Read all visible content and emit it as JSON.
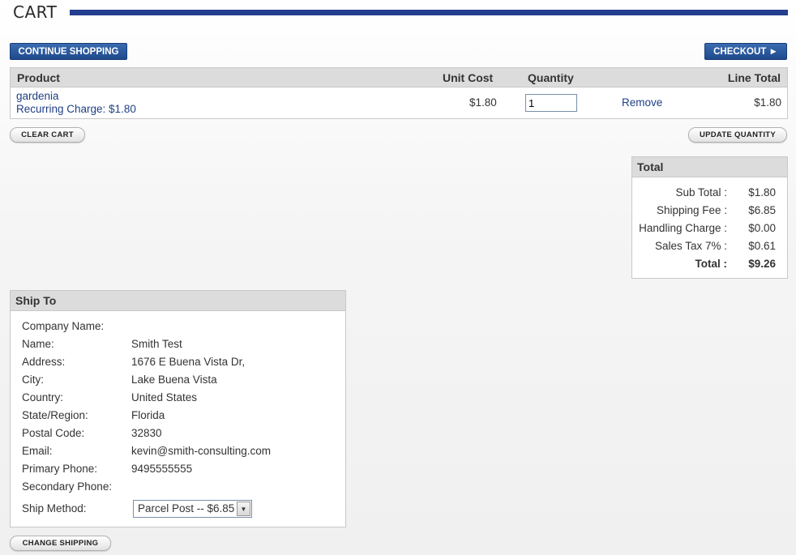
{
  "page": {
    "title": "CART"
  },
  "buttons": {
    "continue_shopping": "CONTINUE SHOPPING",
    "checkout": "CHECKOUT ►",
    "clear_cart": "CLEAR CART",
    "update_quantity": "UPDATE QUANTITY",
    "change_shipping": "CHANGE SHIPPING"
  },
  "cart": {
    "headers": {
      "product": "Product",
      "unit_cost": "Unit Cost",
      "quantity": "Quantity",
      "line_total": "Line Total"
    },
    "items": [
      {
        "name": "gardenia",
        "recurring": "Recurring Charge: $1.80",
        "unit_cost": "$1.80",
        "quantity": "1",
        "remove": "Remove",
        "line_total": "$1.80"
      }
    ]
  },
  "totals": {
    "heading": "Total",
    "rows": [
      {
        "label": "Sub Total :",
        "value": "$1.80"
      },
      {
        "label": "Shipping Fee :",
        "value": "$6.85"
      },
      {
        "label": "Handling Charge :",
        "value": "$0.00"
      },
      {
        "label": "Sales Tax 7% :",
        "value": "$0.61"
      },
      {
        "label": "Total :",
        "value": "$9.26"
      }
    ]
  },
  "ship_to": {
    "heading": "Ship To",
    "rows": [
      {
        "label": "Company Name:",
        "value": ""
      },
      {
        "label": "Name:",
        "value": "Smith Test"
      },
      {
        "label": "Address:",
        "value": "1676 E Buena Vista Dr,"
      },
      {
        "label": "City:",
        "value": "Lake Buena Vista"
      },
      {
        "label": "Country:",
        "value": "United States"
      },
      {
        "label": "State/Region:",
        "value": "Florida"
      },
      {
        "label": "Postal Code:",
        "value": "32830"
      },
      {
        "label": "Email:",
        "value": "kevin@smith-consulting.com"
      },
      {
        "label": "Primary Phone:",
        "value": "9495555555"
      },
      {
        "label": "Secondary Phone:",
        "value": ""
      }
    ],
    "ship_method_label": "Ship Method:",
    "ship_method_value": "Parcel Post -- $6.85"
  },
  "colors": {
    "accent": "#233d8f",
    "button_blue": "#1f4a8c",
    "link": "#1f3f85"
  }
}
